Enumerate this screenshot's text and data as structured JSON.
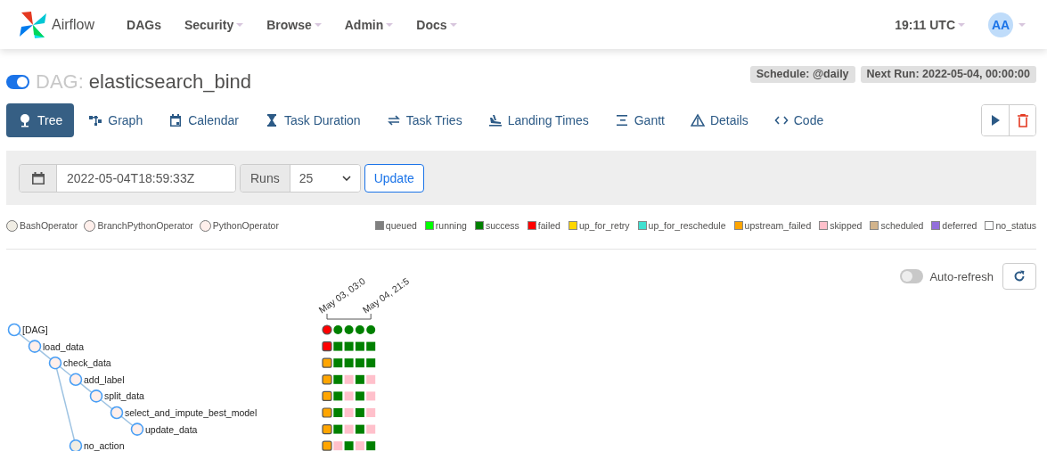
{
  "navbar": {
    "brand": "Airflow",
    "items": [
      {
        "label": "DAGs",
        "dropdown": false
      },
      {
        "label": "Security",
        "dropdown": true
      },
      {
        "label": "Browse",
        "dropdown": true
      },
      {
        "label": "Admin",
        "dropdown": true
      },
      {
        "label": "Docs",
        "dropdown": true
      }
    ],
    "clock": "19:11 UTC",
    "avatar": "AA"
  },
  "dag": {
    "on": true,
    "prefix": "DAG:",
    "name": "elasticsearch_bind",
    "schedule": "Schedule: @daily",
    "next_run": "Next Run: 2022-05-04, 00:00:00"
  },
  "tabs": [
    {
      "label": "Tree",
      "selected": true
    },
    {
      "label": "Graph",
      "selected": false
    },
    {
      "label": "Calendar",
      "selected": false
    },
    {
      "label": "Task Duration",
      "selected": false
    },
    {
      "label": "Task Tries",
      "selected": false
    },
    {
      "label": "Landing Times",
      "selected": false
    },
    {
      "label": "Gantt",
      "selected": false
    },
    {
      "label": "Details",
      "selected": false
    },
    {
      "label": "Code",
      "selected": false
    }
  ],
  "filter": {
    "date": "2022-05-04T18:59:33Z",
    "runs_label": "Runs",
    "runs": "25",
    "button": "Update"
  },
  "operators": [
    {
      "label": "BashOperator",
      "color": "#f0ede4"
    },
    {
      "label": "BranchPythonOperator",
      "color": "#ffefeb"
    },
    {
      "label": "PythonOperator",
      "color": "#ffefeb"
    }
  ],
  "states": [
    {
      "label": "queued",
      "color": "#808080"
    },
    {
      "label": "running",
      "color": "#00ff00"
    },
    {
      "label": "success",
      "color": "#008000"
    },
    {
      "label": "failed",
      "color": "#ff0000"
    },
    {
      "label": "up_for_retry",
      "color": "#ffd700"
    },
    {
      "label": "up_for_reschedule",
      "color": "#40e0d0"
    },
    {
      "label": "upstream_failed",
      "color": "#ffa500"
    },
    {
      "label": "skipped",
      "color": "#ffc0cb"
    },
    {
      "label": "scheduled",
      "color": "#d2b48c"
    },
    {
      "label": "deferred",
      "color": "#9370db"
    },
    {
      "label": "no_status",
      "color": "#ffffff"
    }
  ],
  "auto_refresh": {
    "label": "Auto-refresh",
    "on": false
  },
  "run_dates": [
    "May 03, 03:0",
    "May 04, 21:5"
  ],
  "tree": {
    "label": "[DAG]",
    "kind": "dag",
    "color": "#ffffff",
    "cells": [
      {
        "color": "#ff0000",
        "outlined": true
      },
      {
        "color": "#008000",
        "outlined": false
      },
      {
        "color": "#008000",
        "outlined": false
      },
      {
        "color": "#008000",
        "outlined": false
      },
      {
        "color": "#008000",
        "outlined": false
      }
    ],
    "children": [
      {
        "label": "load_data",
        "kind": "task",
        "color": "#ffefeb",
        "cells": [
          {
            "color": "#ff0000",
            "outlined": true
          },
          {
            "color": "#008000",
            "outlined": false
          },
          {
            "color": "#008000",
            "outlined": false
          },
          {
            "color": "#008000",
            "outlined": false
          },
          {
            "color": "#008000",
            "outlined": false
          }
        ],
        "children": [
          {
            "label": "check_data",
            "kind": "task",
            "color": "#ffefeb",
            "cells": [
              {
                "color": "#ffa500",
                "outlined": true
              },
              {
                "color": "#008000",
                "outlined": false
              },
              {
                "color": "#008000",
                "outlined": false
              },
              {
                "color": "#008000",
                "outlined": false
              },
              {
                "color": "#008000",
                "outlined": false
              }
            ],
            "children": [
              {
                "label": "add_label",
                "kind": "task",
                "color": "#ffefeb",
                "cells": [
                  {
                    "color": "#ffa500",
                    "outlined": true
                  },
                  {
                    "color": "#008000",
                    "outlined": false
                  },
                  {
                    "color": "#ffc0cb",
                    "outlined": false
                  },
                  {
                    "color": "#008000",
                    "outlined": false
                  },
                  {
                    "color": "#ffc0cb",
                    "outlined": false
                  }
                ],
                "children": [
                  {
                    "label": "split_data",
                    "kind": "task",
                    "color": "#ffefeb",
                    "cells": [
                      {
                        "color": "#ffa500",
                        "outlined": true
                      },
                      {
                        "color": "#008000",
                        "outlined": false
                      },
                      {
                        "color": "#ffc0cb",
                        "outlined": false
                      },
                      {
                        "color": "#008000",
                        "outlined": false
                      },
                      {
                        "color": "#ffc0cb",
                        "outlined": false
                      }
                    ],
                    "children": [
                      {
                        "label": "select_and_impute_best_model",
                        "kind": "task",
                        "color": "#ffefeb",
                        "cells": [
                          {
                            "color": "#ffa500",
                            "outlined": true
                          },
                          {
                            "color": "#008000",
                            "outlined": false
                          },
                          {
                            "color": "#ffc0cb",
                            "outlined": false
                          },
                          {
                            "color": "#008000",
                            "outlined": false
                          },
                          {
                            "color": "#ffc0cb",
                            "outlined": false
                          }
                        ],
                        "children": [
                          {
                            "label": "update_data",
                            "kind": "task",
                            "color": "#ffefeb",
                            "cells": [
                              {
                                "color": "#ffa500",
                                "outlined": true
                              },
                              {
                                "color": "#008000",
                                "outlined": false
                              },
                              {
                                "color": "#ffc0cb",
                                "outlined": false
                              },
                              {
                                "color": "#008000",
                                "outlined": false
                              },
                              {
                                "color": "#ffc0cb",
                                "outlined": false
                              }
                            ]
                          }
                        ]
                      }
                    ]
                  }
                ]
              },
              {
                "label": "no_action",
                "kind": "task",
                "color": "#f0ede4",
                "cells": [
                  {
                    "color": "#ffa500",
                    "outlined": true
                  },
                  {
                    "color": "#ffc0cb",
                    "outlined": false
                  },
                  {
                    "color": "#008000",
                    "outlined": false
                  },
                  {
                    "color": "#ffc0cb",
                    "outlined": false
                  },
                  {
                    "color": "#008000",
                    "outlined": false
                  }
                ]
              }
            ]
          }
        ]
      }
    ]
  }
}
